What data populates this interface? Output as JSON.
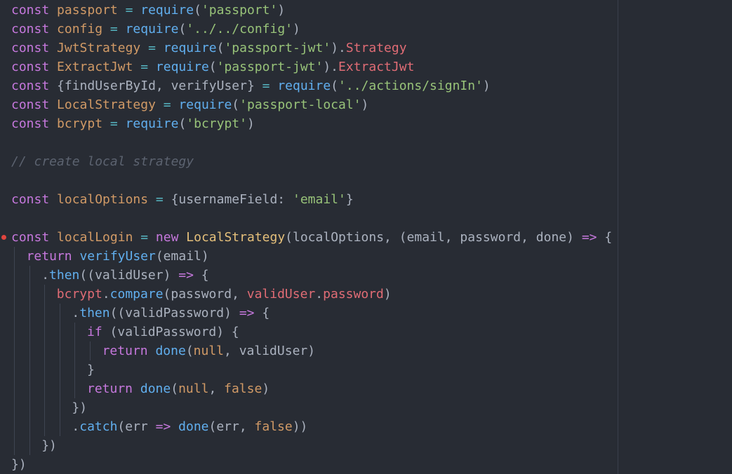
{
  "theme": {
    "background": "#282c34",
    "colors": {
      "kw": "#c678dd",
      "var": "#d19a66",
      "fn": "#61afef",
      "str": "#98c379",
      "prop": "#e06c75",
      "op": "#56b6c2",
      "cls": "#e5c07b",
      "cm": "#5c6370",
      "pl": "#abb2bf"
    },
    "breakpoint_color": "#e0443e"
  },
  "editor": {
    "breakpoint_line_index": 12,
    "lines": [
      {
        "indent": 0,
        "tokens": [
          [
            "const",
            "kw"
          ],
          [
            " ",
            "pl"
          ],
          [
            "passport",
            "var"
          ],
          [
            " = ",
            "op"
          ],
          [
            "require",
            "fn"
          ],
          [
            "(",
            "pl"
          ],
          [
            "'passport'",
            "str"
          ],
          [
            ")",
            "pl"
          ]
        ]
      },
      {
        "indent": 0,
        "tokens": [
          [
            "const",
            "kw"
          ],
          [
            " ",
            "pl"
          ],
          [
            "config",
            "var"
          ],
          [
            " = ",
            "op"
          ],
          [
            "require",
            "fn"
          ],
          [
            "(",
            "pl"
          ],
          [
            "'../../config'",
            "str"
          ],
          [
            ")",
            "pl"
          ]
        ]
      },
      {
        "indent": 0,
        "tokens": [
          [
            "const",
            "kw"
          ],
          [
            " ",
            "pl"
          ],
          [
            "JwtStrategy",
            "var"
          ],
          [
            " = ",
            "op"
          ],
          [
            "require",
            "fn"
          ],
          [
            "(",
            "pl"
          ],
          [
            "'passport-jwt'",
            "str"
          ],
          [
            ").",
            "pl"
          ],
          [
            "Strategy",
            "prop"
          ]
        ]
      },
      {
        "indent": 0,
        "tokens": [
          [
            "const",
            "kw"
          ],
          [
            " ",
            "pl"
          ],
          [
            "ExtractJwt",
            "var"
          ],
          [
            " = ",
            "op"
          ],
          [
            "require",
            "fn"
          ],
          [
            "(",
            "pl"
          ],
          [
            "'passport-jwt'",
            "str"
          ],
          [
            ").",
            "pl"
          ],
          [
            "ExtractJwt",
            "prop"
          ]
        ]
      },
      {
        "indent": 0,
        "tokens": [
          [
            "const",
            "kw"
          ],
          [
            " ",
            "pl"
          ],
          [
            "{findUserById, verifyUser}",
            "pl"
          ],
          [
            " = ",
            "op"
          ],
          [
            "require",
            "fn"
          ],
          [
            "(",
            "pl"
          ],
          [
            "'../actions/signIn'",
            "str"
          ],
          [
            ")",
            "pl"
          ]
        ]
      },
      {
        "indent": 0,
        "tokens": [
          [
            "const",
            "kw"
          ],
          [
            " ",
            "pl"
          ],
          [
            "LocalStrategy",
            "var"
          ],
          [
            " = ",
            "op"
          ],
          [
            "require",
            "fn"
          ],
          [
            "(",
            "pl"
          ],
          [
            "'passport-local'",
            "str"
          ],
          [
            ")",
            "pl"
          ]
        ]
      },
      {
        "indent": 0,
        "tokens": [
          [
            "const",
            "kw"
          ],
          [
            " ",
            "pl"
          ],
          [
            "bcrypt",
            "var"
          ],
          [
            " = ",
            "op"
          ],
          [
            "require",
            "fn"
          ],
          [
            "(",
            "pl"
          ],
          [
            "'bcrypt'",
            "str"
          ],
          [
            ")",
            "pl"
          ]
        ]
      },
      {
        "indent": 0,
        "tokens": []
      },
      {
        "indent": 0,
        "tokens": [
          [
            "// create local strategy",
            "cm"
          ]
        ]
      },
      {
        "indent": 0,
        "tokens": []
      },
      {
        "indent": 0,
        "tokens": [
          [
            "const",
            "kw"
          ],
          [
            " ",
            "pl"
          ],
          [
            "localOptions",
            "var"
          ],
          [
            " = ",
            "op"
          ],
          [
            "{usernameField: ",
            "pl"
          ],
          [
            "'email'",
            "str"
          ],
          [
            "}",
            "pl"
          ]
        ]
      },
      {
        "indent": 0,
        "tokens": []
      },
      {
        "indent": 0,
        "tokens": [
          [
            "const",
            "kw"
          ],
          [
            " ",
            "pl"
          ],
          [
            "localLogin",
            "var"
          ],
          [
            " = ",
            "op"
          ],
          [
            "new",
            "kw"
          ],
          [
            " ",
            "pl"
          ],
          [
            "LocalStrategy",
            "cls"
          ],
          [
            "(localOptions, (email, password, done) ",
            "pl"
          ],
          [
            "=>",
            "kw"
          ],
          [
            " ",
            "pl"
          ],
          [
            "{",
            "pl"
          ]
        ]
      },
      {
        "indent": 1,
        "tokens": [
          [
            "return",
            "kw"
          ],
          [
            " ",
            "pl"
          ],
          [
            "verifyUser",
            "fn"
          ],
          [
            "(email)",
            "pl"
          ]
        ]
      },
      {
        "indent": 2,
        "tokens": [
          [
            ".",
            "pl"
          ],
          [
            "then",
            "fn"
          ],
          [
            "((validUser) ",
            "pl"
          ],
          [
            "=>",
            "kw"
          ],
          [
            " {",
            "pl"
          ]
        ]
      },
      {
        "indent": 3,
        "tokens": [
          [
            "bcrypt",
            "prop"
          ],
          [
            ".",
            "pl"
          ],
          [
            "compare",
            "fn"
          ],
          [
            "(password, ",
            "pl"
          ],
          [
            "validUser",
            "prop"
          ],
          [
            ".",
            "pl"
          ],
          [
            "password",
            "prop"
          ],
          [
            ")",
            "pl"
          ]
        ]
      },
      {
        "indent": 4,
        "tokens": [
          [
            ".",
            "pl"
          ],
          [
            "then",
            "fn"
          ],
          [
            "((validPassword) ",
            "pl"
          ],
          [
            "=>",
            "kw"
          ],
          [
            " {",
            "pl"
          ]
        ]
      },
      {
        "indent": 5,
        "tokens": [
          [
            "if",
            "kw"
          ],
          [
            " (validPassword) {",
            "pl"
          ]
        ]
      },
      {
        "indent": 6,
        "tokens": [
          [
            "return",
            "kw"
          ],
          [
            " ",
            "pl"
          ],
          [
            "done",
            "fn"
          ],
          [
            "(",
            "pl"
          ],
          [
            "null",
            "var"
          ],
          [
            ", validUser)",
            "pl"
          ]
        ]
      },
      {
        "indent": 5,
        "tokens": [
          [
            "}",
            "pl"
          ]
        ]
      },
      {
        "indent": 5,
        "tokens": [
          [
            "return",
            "kw"
          ],
          [
            " ",
            "pl"
          ],
          [
            "done",
            "fn"
          ],
          [
            "(",
            "pl"
          ],
          [
            "null",
            "var"
          ],
          [
            ", ",
            "pl"
          ],
          [
            "false",
            "var"
          ],
          [
            ")",
            "pl"
          ]
        ]
      },
      {
        "indent": 4,
        "tokens": [
          [
            "})",
            "pl"
          ]
        ]
      },
      {
        "indent": 4,
        "tokens": [
          [
            ".",
            "pl"
          ],
          [
            "catch",
            "fn"
          ],
          [
            "(err ",
            "pl"
          ],
          [
            "=>",
            "kw"
          ],
          [
            " ",
            "pl"
          ],
          [
            "done",
            "fn"
          ],
          [
            "(err, ",
            "pl"
          ],
          [
            "false",
            "var"
          ],
          [
            "))",
            "pl"
          ]
        ]
      },
      {
        "indent": 2,
        "tokens": [
          [
            "})",
            "pl"
          ]
        ]
      },
      {
        "indent": 0,
        "tokens": [
          [
            "})",
            "pl"
          ]
        ]
      }
    ]
  }
}
